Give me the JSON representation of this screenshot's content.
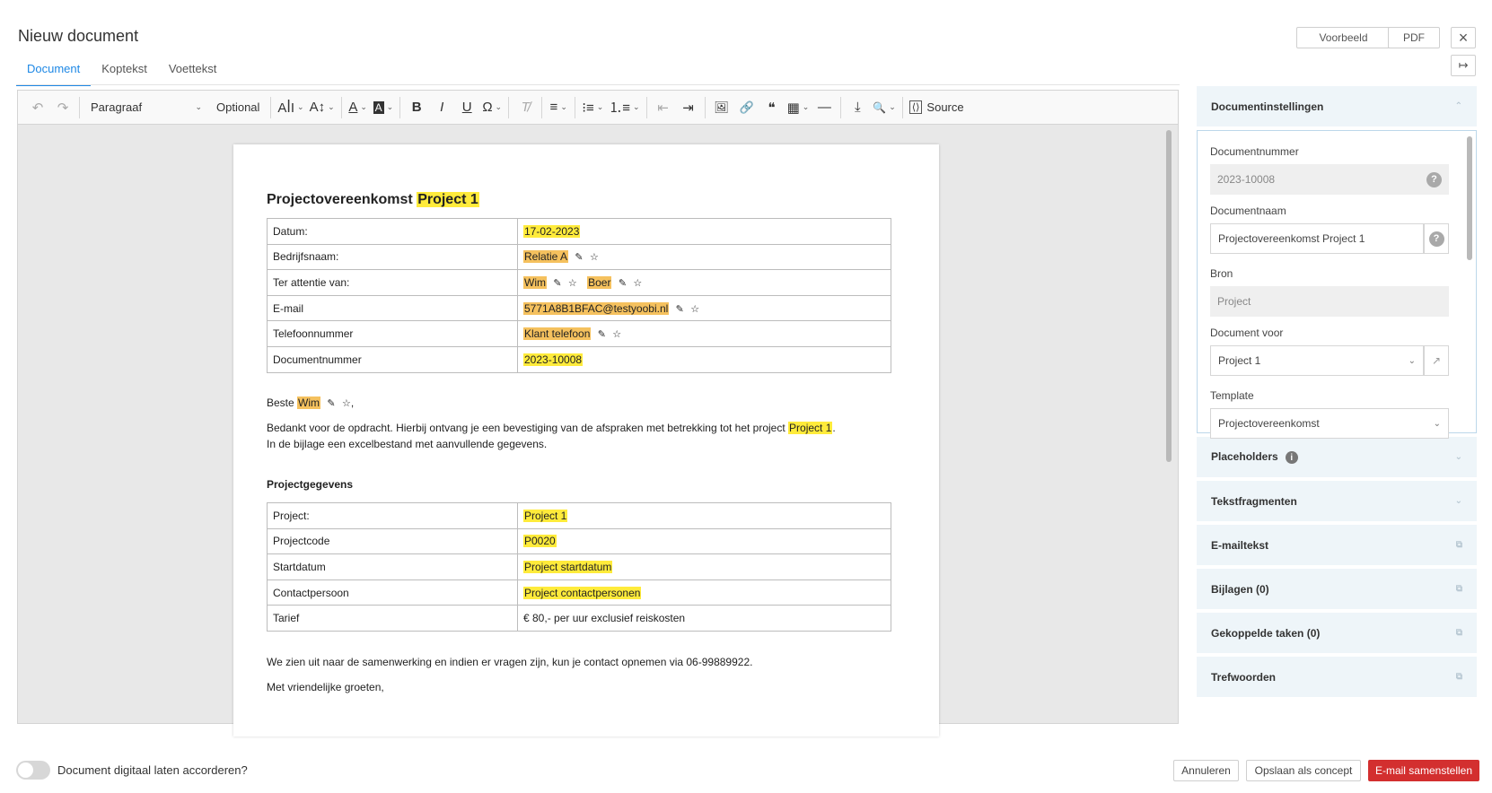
{
  "header": {
    "title": "Nieuw document",
    "tabs": [
      {
        "label": "Document",
        "active": true
      },
      {
        "label": "Koptekst",
        "active": false
      },
      {
        "label": "Voettekst",
        "active": false
      }
    ],
    "preview_label": "Voorbeeld",
    "pdf_label": "PDF",
    "close_icon": "×",
    "collapse_icon": "↦"
  },
  "toolbar": {
    "undo_icon": "↶",
    "redo_icon": "↷",
    "paragraph_label": "Paragraaf",
    "paragraph_chevron": "⌄",
    "optional_label": "Optional",
    "font_size_icon": "AꟾI",
    "line_height_icon": "A↕",
    "font_color_icon": "A",
    "bg_color_icon": "A",
    "bold_icon": "B",
    "italic_icon": "I",
    "underline_icon": "U",
    "special_char_icon": "Ω",
    "remove_format_icon": "T̸",
    "align_icon": "≡",
    "bullet_list_icon": "⁝≡",
    "numbered_list_icon": "⒈≡",
    "outdent_icon": "⇤",
    "indent_icon": "⇥",
    "image_icon": "🖼",
    "link_icon": "🔗",
    "quote_icon": "❝",
    "table_icon": "▦",
    "hr_icon": "—",
    "page_break_icon": "⤓",
    "find_icon": "🔍",
    "source_icon": "⟨⟩",
    "source_label": "Source"
  },
  "document": {
    "title": "Projectovereenkomst",
    "title_placeholder": "Project 1",
    "table1": [
      {
        "label": "Datum:",
        "value": "17-02-2023",
        "style": "yellow",
        "icons": false
      },
      {
        "label": "Bedrijfsnaam:",
        "value": "Relatie A",
        "style": "orange",
        "icons": true
      },
      {
        "label": "Ter attentie van:",
        "value": "Wim",
        "value2": "Boer",
        "style": "orange",
        "icons": true
      },
      {
        "label": "E-mail",
        "value": "5771A8B1BFAC@testyoobi.nl",
        "style": "orange",
        "icons": true
      },
      {
        "label": "Telefoonnummer",
        "value": "Klant telefoon",
        "style": "orange",
        "icons": true
      },
      {
        "label": "Documentnummer",
        "value": "2023-10008",
        "style": "yellow",
        "icons": false
      }
    ],
    "greeting_prefix": "Beste",
    "greeting_name": "Wim",
    "greeting_suffix": ",",
    "edit_icon": "✎",
    "star_icon": "☆",
    "body_line1": "Bedankt voor de opdracht. Hierbij ontvang je een bevestiging van de afspraken met betrekking tot het project",
    "body_line1_placeholder": "Project 1",
    "body_line1_end": ".",
    "body_line2": "In de bijlage een excelbestand met aanvullende gegevens.",
    "section_heading": "Projectgegevens",
    "table2": [
      {
        "label": "Project:",
        "value": "Project 1",
        "style": "yellow"
      },
      {
        "label": "Projectcode",
        "value": "P0020",
        "style": "yellow"
      },
      {
        "label": "Startdatum",
        "value": "Project startdatum",
        "style": "yellow"
      },
      {
        "label": "Contactpersoon",
        "value": "Project contactpersonen",
        "style": "yellow"
      },
      {
        "label": "Tarief",
        "value": "€ 80,- per uur exclusief reiskosten",
        "style": "none"
      }
    ],
    "closing_line": "We zien uit naar de samenwerking en indien er vragen zijn, kun je contact opnemen via 06-99889922.",
    "regards_line": "Met vriendelijke groeten,"
  },
  "panel": {
    "settings_title": "Documentinstellingen",
    "chev_up": "⌃",
    "chev_down": "⌄",
    "open_icon": "⧉",
    "fields": {
      "docnumber_label": "Documentnummer",
      "docnumber_value": "2023-10008",
      "docname_label": "Documentnaam",
      "docname_value": "Projectovereenkomst Project 1",
      "source_label": "Bron",
      "source_value": "Project",
      "docfor_label": "Document voor",
      "docfor_value": "Project 1",
      "template_label": "Template",
      "template_value": "Projectovereenkomst",
      "help_icon": "?",
      "external_icon": "↗"
    },
    "sections": [
      {
        "label": "Placeholders",
        "info": true,
        "chev": "⌄"
      },
      {
        "label": "Tekstfragmenten",
        "info": false,
        "chev": "⌄"
      },
      {
        "label": "E-mailtekst",
        "info": false,
        "chev": "⧉"
      },
      {
        "label": "Bijlagen (0)",
        "info": false,
        "chev": "⧉"
      },
      {
        "label": "Gekoppelde taken (0)",
        "info": false,
        "chev": "⧉"
      },
      {
        "label": "Trefwoorden",
        "info": false,
        "chev": "⧉"
      }
    ],
    "info_icon": "i"
  },
  "footer": {
    "toggle_label": "Document digitaal laten accorderen?",
    "toggle_on": false,
    "cancel_label": "Annuleren",
    "draft_label": "Opslaan als concept",
    "email_label": "E-mail samenstellen"
  },
  "colors": {
    "accent": "#1e88e5",
    "highlight_yellow": "#ffeb3b",
    "highlight_orange": "#f5c15e",
    "primary_red": "#d32f2f",
    "panel_header_bg": "#eef5f9"
  }
}
